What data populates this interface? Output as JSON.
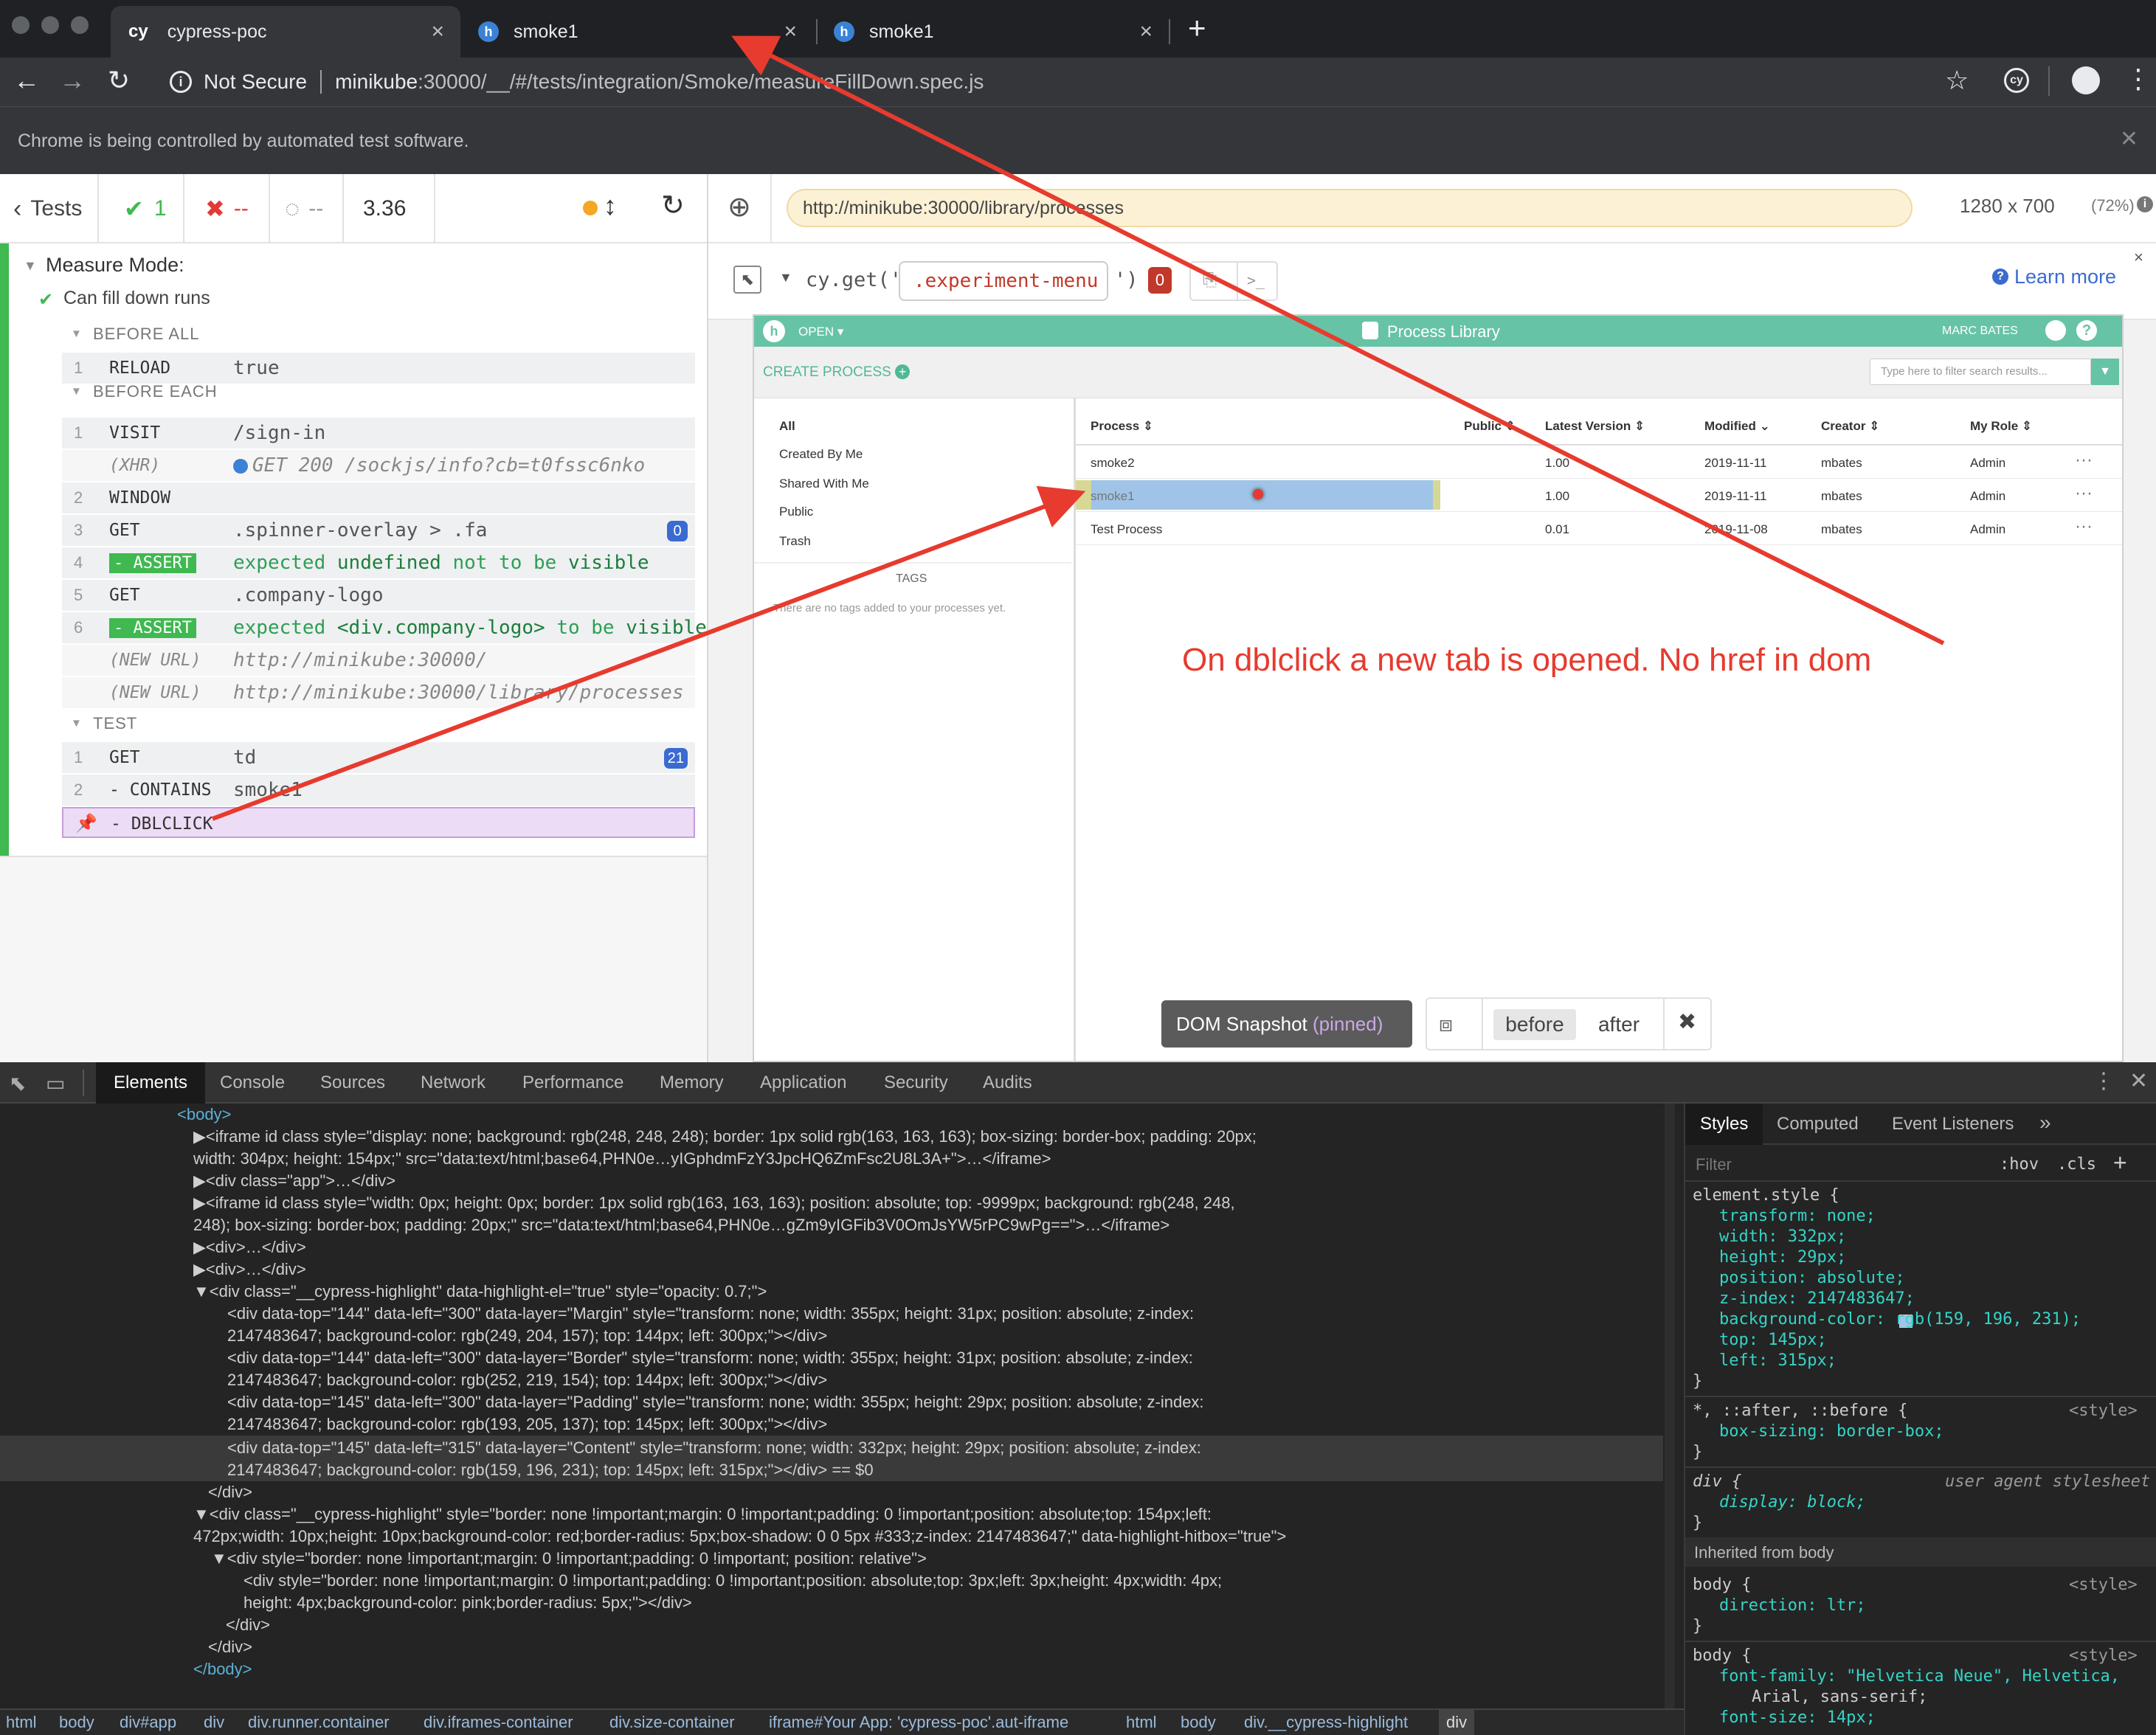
{
  "browser": {
    "tabs": [
      {
        "label": "cypress-poc",
        "icon": "cy"
      },
      {
        "label": "smoke1",
        "icon": "h"
      },
      {
        "label": "smoke1",
        "icon": "h"
      }
    ],
    "new_tab_glyph": "+",
    "close_glyph": "×",
    "security_label": "Not Secure",
    "url_host": "minikube",
    "url_rest": ":30000/__/#/tests/integration/Smoke/measureFillDown.spec.js",
    "automation_notice": "Chrome is being controlled by automated test software."
  },
  "reporter": {
    "tests_label": "Tests",
    "passed": "1",
    "failed": "--",
    "pending": "--",
    "duration": "3.36",
    "suite_title": "Measure Mode:",
    "test_title": "Can fill down runs",
    "sections": {
      "before_all": "BEFORE ALL",
      "before_each": "BEFORE EACH",
      "test": "TEST"
    },
    "before_all_cmds": [
      {
        "num": "1",
        "name": "RELOAD",
        "msg": "true"
      }
    ],
    "before_each_cmds": [
      {
        "num": "1",
        "name": "VISIT",
        "msg": "/sign-in"
      },
      {
        "num": "",
        "name": "(XHR)",
        "msg": "GET 200 /sockjs/info?cb=t0fssc6nko"
      },
      {
        "num": "2",
        "name": "WINDOW",
        "msg": ""
      },
      {
        "num": "3",
        "name": "GET",
        "msg": ".spinner-overlay > .fa",
        "badge": "0"
      },
      {
        "num": "4",
        "name": "- ASSERT",
        "msg_parts": [
          "expected",
          "undefined",
          "not to be",
          "visible"
        ]
      },
      {
        "num": "5",
        "name": "GET",
        "msg": ".company-logo"
      },
      {
        "num": "6",
        "name": "- ASSERT",
        "msg_parts": [
          "expected",
          "<div.company-logo>",
          "to be",
          "visible"
        ]
      },
      {
        "num": "",
        "name": "(NEW URL)",
        "msg": "http://minikube:30000/"
      },
      {
        "num": "",
        "name": "(NEW URL)",
        "msg": "http://minikube:30000/library/processes"
      }
    ],
    "test_cmds": [
      {
        "num": "1",
        "name": "GET",
        "msg": "td",
        "badge": "21"
      },
      {
        "num": "2",
        "name": "- CONTAINS",
        "msg": "smoke1"
      },
      {
        "num": "",
        "name": "- DBLCLICK",
        "msg": ""
      }
    ]
  },
  "aut": {
    "url": "http://minikube:30000/library/processes",
    "viewport": "1280 x 700",
    "scale": "(72%)",
    "selector_prefix": "cy.get('",
    "selector_value": ".experiment-menu",
    "selector_suffix": "')",
    "selector_count": "0",
    "learn_more": "Learn more",
    "app": {
      "open_menu": "OPEN",
      "title": "Process Library",
      "user": "MARC BATES",
      "create_process": "CREATE PROCESS",
      "filter_placeholder": "Type here to filter search results...",
      "sidebar": [
        "All",
        "Created By Me",
        "Shared With Me",
        "Public",
        "Trash"
      ],
      "tags_heading": "TAGS",
      "tags_empty": "There are no tags added to your processes yet.",
      "columns": [
        "Process",
        "Public",
        "Latest Version",
        "Modified",
        "Creator",
        "My Role"
      ],
      "rows": [
        {
          "process": "smoke2",
          "version": "1.00",
          "modified": "2019-11-11",
          "creator": "mbates",
          "role": "Admin"
        },
        {
          "process": "smoke1",
          "version": "1.00",
          "modified": "2019-11-11",
          "creator": "mbates",
          "role": "Admin"
        },
        {
          "process": "Test Process",
          "version": "0.01",
          "modified": "2019-11-08",
          "creator": "mbates",
          "role": "Admin"
        }
      ],
      "row_menu": "···"
    },
    "snapshot_label": "DOM Snapshot",
    "snapshot_state": "(pinned)",
    "before_label": "before",
    "after_label": "after"
  },
  "annotation": "On dblclick a new tab is opened. No href in dom",
  "devtools": {
    "tabs": [
      "Elements",
      "Console",
      "Sources",
      "Network",
      "Performance",
      "Memory",
      "Application",
      "Security",
      "Audits"
    ],
    "lines": [
      "<body>",
      "▶<iframe id class style=\"display: none; background: rgb(248, 248, 248); border: 1px solid rgb(163, 163, 163); box-sizing: border-box; padding: 20px;",
      "width: 304px; height: 154px;\" src=\"data:text/html;base64,PHN0e…yIGphdmFzY3JpcHQ6ZmFsc2U8L3A+\">…</iframe>",
      "▶<div class=\"app\">…</div>",
      "▶<iframe id class style=\"width: 0px; height: 0px; border: 1px solid rgb(163, 163, 163); position: absolute; top: -9999px; background: rgb(248, 248,",
      "248); box-sizing: border-box; padding: 20px;\" src=\"data:text/html;base64,PHN0e…gZm9yIGFib3V0OmJsYW5rPC9wPg==\">…</iframe>",
      "▶<div>…</div>",
      "▶<div>…</div>",
      "▼<div class=\"__cypress-highlight\" data-highlight-el=\"true\" style=\"opacity: 0.7;\">",
      "<div data-top=\"144\" data-left=\"300\" data-layer=\"Margin\" style=\"transform: none; width: 355px; height: 31px; position: absolute; z-index:",
      "2147483647; background-color: rgb(249, 204, 157); top: 144px; left: 300px;\"></div>",
      "<div data-top=\"144\" data-left=\"300\" data-layer=\"Border\" style=\"transform: none; width: 355px; height: 31px; position: absolute; z-index:",
      "2147483647; background-color: rgb(252, 219, 154); top: 144px; left: 300px;\"></div>",
      "<div data-top=\"145\" data-left=\"300\" data-layer=\"Padding\" style=\"transform: none; width: 355px; height: 29px; position: absolute; z-index:",
      "2147483647; background-color: rgb(193, 205, 137); top: 145px; left: 300px;\"></div>",
      "<div data-top=\"145\" data-left=\"315\" data-layer=\"Content\" style=\"transform: none; width: 332px; height: 29px; position: absolute; z-index:",
      "2147483647; background-color: rgb(159, 196, 231); top: 145px; left: 315px;\"></div> == $0",
      "</div>",
      "▼<div class=\"__cypress-highlight\" style=\"border: none !important;margin: 0 !important;padding: 0 !important;position: absolute;top: 154px;left:",
      "472px;width: 10px;height: 10px;background-color: red;border-radius: 5px;box-shadow: 0 0 5px #333;z-index: 2147483647;\" data-highlight-hitbox=\"true\">",
      "▼<div style=\"border: none !important;margin: 0 !important;padding: 0 !important; position: relative\">",
      "<div style=\"border: none !important;margin: 0 !important;padding: 0 !important;position: absolute;top: 3px;left: 3px;height: 4px;width: 4px;",
      "height: 4px;background-color: pink;border-radius: 5px;\"></div>",
      "</div>",
      "</div>",
      "</body>"
    ],
    "styles_tabs": [
      "Styles",
      "Computed",
      "Event Listeners",
      "»"
    ],
    "filter_placeholder": "Filter",
    "hov": ":hov",
    "cls": ".cls",
    "style_lines": [
      "element.style {",
      "transform: none;",
      "width: 332px;",
      "height: 29px;",
      "position: absolute;",
      "z-index: 2147483647;",
      "background-color: rgb(159, 196, 231);",
      "top: 145px;",
      "left: 315px;",
      "}",
      "*, ::after, ::before {",
      "box-sizing: border-box;",
      "}",
      "div {",
      "display: block;",
      "}",
      "Inherited from body",
      "body {",
      "direction: ltr;",
      "}",
      "body {",
      "font-family: \"Helvetica Neue\", Helvetica,",
      "Arial, sans-serif;",
      "font-size: 14px;"
    ],
    "style_origin": "<style>",
    "ua_origin": "user agent stylesheet",
    "crumbs": [
      "html",
      "body",
      "div#app",
      "div",
      "div.runner.container",
      "div.iframes-container",
      "div.size-container",
      "iframe#Your App: 'cypress-poc'.aut-iframe",
      "html",
      "body",
      "div.__cypress-highlight",
      "div"
    ]
  },
  "colors": {
    "accent_green": "#3fb950",
    "annotation_red": "#e63b2e",
    "app_teal": "#67c3a6",
    "highlight_blue": "#9fc4e7"
  }
}
